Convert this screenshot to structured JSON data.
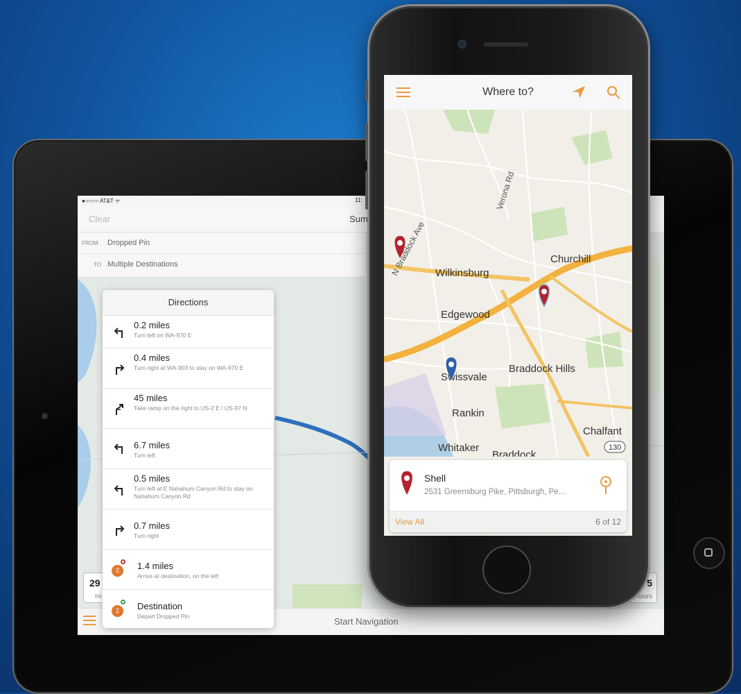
{
  "ipad": {
    "status": {
      "carrier": "●○○○○ AT&T ᯤ",
      "time": "11:"
    },
    "top_bar": {
      "clear_label": "Clear",
      "summary_label": "Sum"
    },
    "route": {
      "from_label": "FROM",
      "from_value": "Dropped Pin",
      "to_label": "TO",
      "to_value": "Multiple Destinations"
    },
    "directions": {
      "title": "Directions",
      "steps": [
        {
          "distance": "0.2 miles",
          "description": "Turn left on WA-970 E",
          "icon": "turn-left-icon"
        },
        {
          "distance": "0.4 miles",
          "description": "Turn right at WA-903 to stay on WA-970 E",
          "icon": "turn-right-icon"
        },
        {
          "distance": "45 miles",
          "description": "Take ramp on the right to US-2 E / US-97 N",
          "icon": "ramp-right-icon"
        },
        {
          "distance": "6.7 miles",
          "description": "Turn left",
          "icon": "turn-left-icon"
        },
        {
          "distance": "0.5 miles",
          "description": "Turn left at E Nahahum Canyon Rd to stay on Nahahum Canyon Rd",
          "icon": "turn-left-icon"
        },
        {
          "distance": "0.7 miles",
          "description": "Turn right",
          "icon": "turn-right-icon"
        },
        {
          "distance": "1.4 miles",
          "description": "Arrive at destination, on the left",
          "icon": "destination-badge-icon",
          "badge": "2"
        },
        {
          "distance": "Destination",
          "description": "Depart Dropped Pin",
          "icon": "origin-badge-icon",
          "badge": "2"
        }
      ]
    },
    "stats": {
      "left_value": "29",
      "left_unit": "mi",
      "right_value": "5",
      "right_unit": "hours"
    },
    "bottom_bar": {
      "start_label": "Start Navigation"
    },
    "colors": {
      "accent": "#e89a3b",
      "route": "#3a7fc8"
    }
  },
  "iphone": {
    "nav": {
      "title": "Where to?"
    },
    "map_labels": {
      "verona": "Verona Rd",
      "braddock_ave": "N Braddock Ave",
      "wilkinsburg": "Wilkinsburg",
      "churchill": "Churchill",
      "edgewood": "Edgewood",
      "swissvale": "Swissvale",
      "braddock_hills": "Braddock Hills",
      "rankin": "Rankin",
      "chalfant": "Chalfant",
      "whitaker": "Whitaker",
      "braddock": "Braddock",
      "route_shield": "130"
    },
    "card": {
      "name": "Shell",
      "address": "2531 Greensburg Pike, Pittsburgh, Pe...",
      "view_all": "View All",
      "count": "6 of 12"
    },
    "colors": {
      "accent": "#e89a3b",
      "pin_red": "#b3242e",
      "pin_blue": "#2e5fa8",
      "highway": "#f3b23e"
    }
  }
}
